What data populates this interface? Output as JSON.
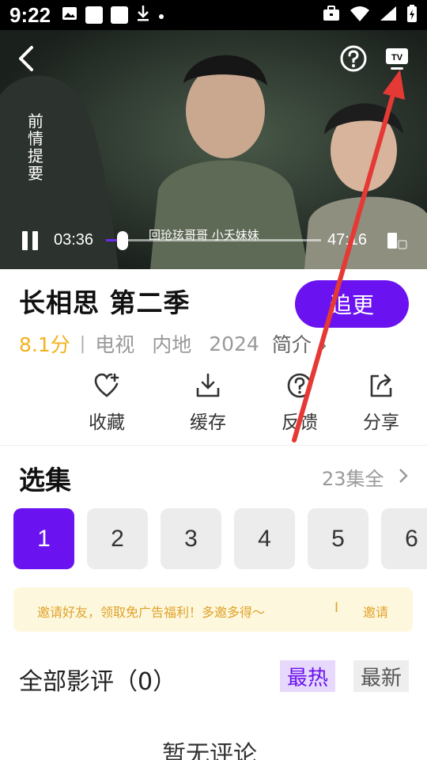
{
  "status_bar": {
    "time": "9:22"
  },
  "player": {
    "recap_label": "前\n情\n提\n要",
    "current_time": "03:36",
    "total_time": "47:16",
    "progress_fraction": 0.076,
    "episode_tip": "回玱玹哥哥 小夭妹妹"
  },
  "show": {
    "title": "长相思 第二季",
    "follow_label": "追更",
    "score": "8.1分",
    "separator": "|",
    "category": "电视",
    "region": "内地",
    "year": "2024",
    "intro_label": "简介"
  },
  "actions": [
    {
      "label": "收藏",
      "icon": "heart-plus-icon"
    },
    {
      "label": "缓存",
      "icon": "download-icon"
    },
    {
      "label": "反馈",
      "icon": "help-circle-icon"
    },
    {
      "label": "分享",
      "icon": "share-icon"
    }
  ],
  "episodes": {
    "heading": "选集",
    "count_label": "23集全",
    "items": [
      "1",
      "2",
      "3",
      "4",
      "5",
      "6"
    ],
    "selected": "1"
  },
  "invite": {
    "text": "邀请好友，领取免广告福利！多邀多得～",
    "separator": "I",
    "link": "邀请"
  },
  "reviews": {
    "heading": "全部影评（0）",
    "sort_hot": "最热",
    "sort_new": "最新",
    "empty_text": "暂无评论"
  },
  "colors": {
    "accent": "#6b12f0",
    "score": "#f2b21b",
    "annotation": "#e53935"
  }
}
